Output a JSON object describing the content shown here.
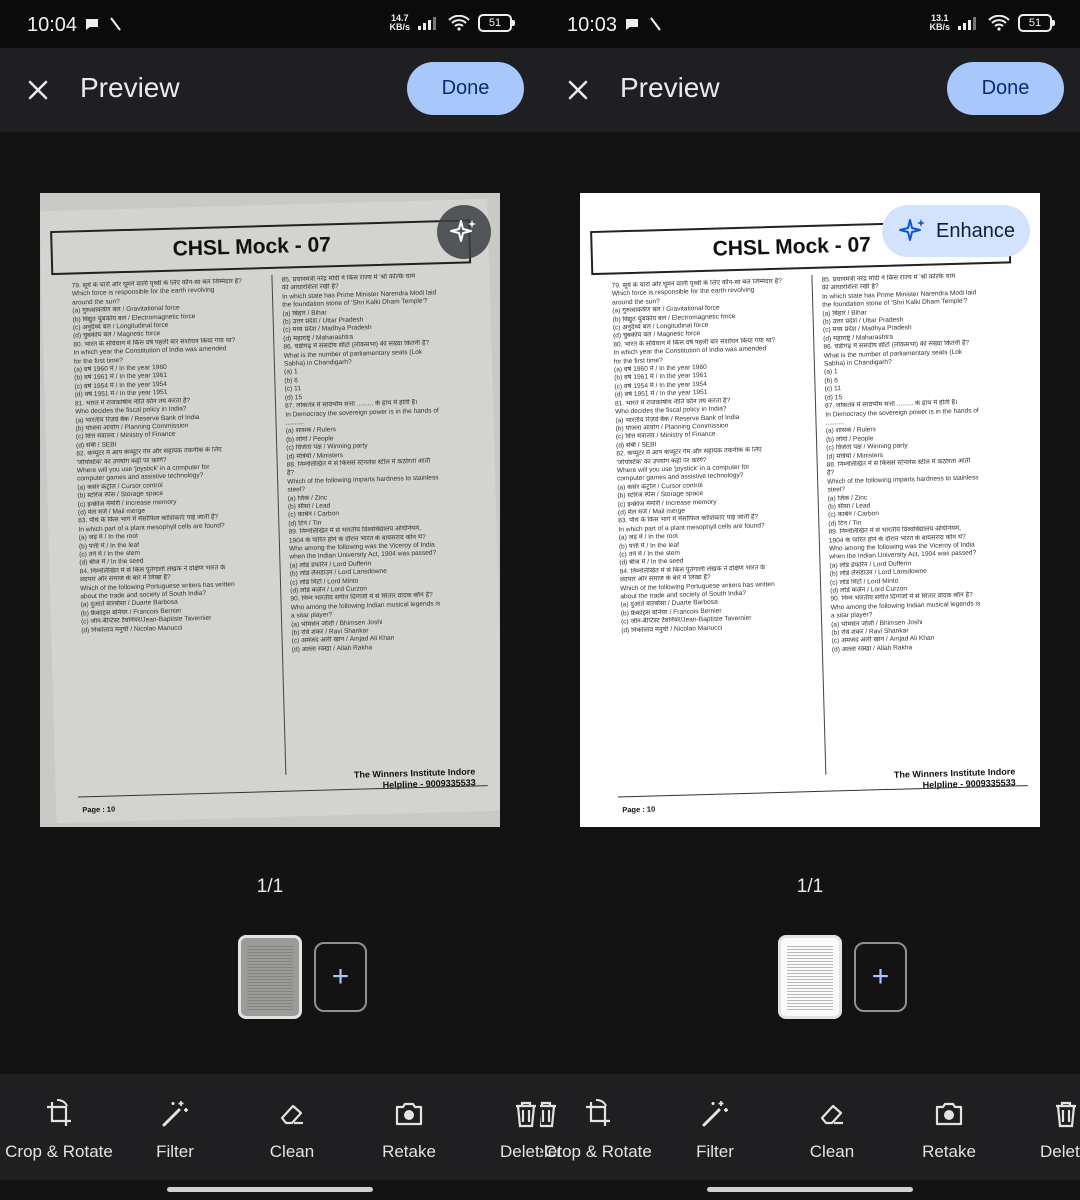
{
  "panels": [
    {
      "status": {
        "time": "10:04",
        "net_speed_top": "14.7",
        "net_speed_unit": "KB/s",
        "battery": "51"
      },
      "header": {
        "title": "Preview",
        "done_label": "Done"
      },
      "page_counter": "1/1",
      "tools": [
        "Crop & Rotate",
        "Filter",
        "Clean",
        "Retake",
        "Delet"
      ]
    },
    {
      "status": {
        "time": "10:03",
        "net_speed_top": "13.1",
        "net_speed_unit": "KB/s",
        "battery": "51"
      },
      "header": {
        "title": "Preview",
        "done_label": "Done"
      },
      "enhance_label": "Enhance",
      "page_counter": "1/1",
      "tools": [
        "Delet",
        "Crop & Rotate",
        "Filter",
        "Clean",
        "Retake",
        "Delet"
      ]
    }
  ],
  "document": {
    "title": "CHSL Mock - 07",
    "footer_org": "The Winners Institute Indore",
    "footer_helpline": "Helpline - 9009335533",
    "page_label": "Page : 10",
    "left_column": [
      "79. सूर्य के चारों ओर घूमने वाली पृथ्वी के लिए कौन-सा बल जिम्मेदार है?",
      "Which force is responsible for the earth revolving",
      "around the sun?",
      "(a) गुरुत्वाकर्षण बल / Gravitational force",
      "(b) विद्युत चुंबकीय बल / Electromagnetic force",
      "(c) अनुदैर्ध्य बल / Longitudinal force",
      "(d) चुंबकीय बल / Magnetic force",
      "80. भारत के संविधान में किस वर्ष पहली बार संशोधन किया गया था?",
      "In which year the Constitution of India was amended",
      "for the first time?",
      "(a) वर्ष 1960 में / In the year 1960",
      "(b) वर्ष 1961 में / In the year 1961",
      "(c) वर्ष 1954 में / In the year 1954",
      "(d) वर्ष 1951 में / In the year 1951",
      "81. भारत में राजकोषीय नीति कौन तय करता है?",
      "Who decides the fiscal policy in India?",
      "(a) भारतीय रिज़र्व बैंक / Reserve Bank of India",
      "(b) योजना आयोग / Planning Commission",
      "(c) वित्त मंत्रालय / Ministry of Finance",
      "(d) सेबी / SEBI",
      "82. कंप्यूटर में आप कंप्यूटर गेम और सहायक तकनीक के लिए",
      "'जॉयस्टिक' का उपयोग कहाँ पर करेंगे?",
      "Where will you use 'joystick' in a computer for",
      "computer games and assistive technology?",
      "(a) कर्सर कंट्रोल / Cursor control",
      "(b) स्टोरेज स्पेस / Storage space",
      "(c) इन्क्रीज मेमोरी / Increase memory",
      "(d) मेल मर्ज / Mail merge",
      "83. पौधे के किस भाग में मेसोफिल कोशिकाएं पाई जाती हैं?",
      "In which part of a plant mesophyll cells are found?",
      "(a) जड़ में / In the root",
      "(b) पत्ती में / In the leaf",
      "(c) तने में / In the stem",
      "(d) बीज में / In the seed",
      "84. निम्नलिखित में से किस पुर्तगाली लेखक ने दक्षिण भारत के",
      "व्यापार और समाज के बारे में लिखा है?",
      "Which of the following Portuguese writers has written",
      "about the trade and society of South India?",
      "(a) दुआर्ते बारबोसा / Duarte Barbosa",
      "(b) फ्रैंकोइस बर्नियर / Francois Bernier",
      "(c) जीन-बैप्टिस्ट टैवर्नियर/Jean-Baptiste Tavernier",
      "(d) निकोलाव मनुची / Nicolao Manucci"
    ],
    "right_column": [
      "85. प्रधानमंत्री नरेंद्र मोदी ने किस राज्य में 'श्री कल्कि धाम",
      "की आधारशिला रखी है?",
      "In which state has Prime Minister Narendra Modi laid",
      "the foundation stone of 'Shri Kalki Dham Temple'?",
      "(a) बिहार / Bihar",
      "(b) उत्तर प्रदेश / Uttar Pradesh",
      "(c) मध्य प्रदेश / Madhya Pradesh",
      "(d) महाराष्ट्र / Maharashtra",
      "86. चंडीगढ़ में संसदीय सीटों (लोकसभा) की संख्या कितनी है?",
      "What is the number of parliamentary seats (Lok",
      "Sabha) in Chandigarh?",
      "(a) 1",
      "(b) 6",
      "(c) 11",
      "(d) 15",
      "87. लोकतंत्र में सार्वभौम सत्ता ......... के हाथ में होती है।",
      "In Democracy the sovereign power is in the hands of",
      "..........",
      "(a) शासक / Rulers",
      "(b) लोगों / People",
      "(c) विजेता पक्ष / Winning party",
      "(d) मंत्रियों / Ministers",
      "88. निम्नलिखित में से किससे स्टेनलेस स्टील में कठोरता आती",
      "है?",
      "Which of the following imparts hardness to stainless",
      "steel?",
      "(a) जिंक / Zinc",
      "(b) सीसा / Lead",
      "(c) कार्बन / Carbon",
      "(d) टिन / Tin",
      "89. निम्नलिखित में से भारतीय विश्वविद्यालय अधिनियम,",
      "1904 के पारित होने के दौरान भारत के वायसराय कौन थे?",
      "Who among the following was the Viceroy of India",
      "when the Indian University Act, 1904 was passed?",
      "(a) लॉर्ड डफरिन / Lord Dufferin",
      "(b) लॉर्ड लैंसडाउन / Lord Lansdowne",
      "(c) लॉर्ड मिंटो / Lord Minto",
      "(d) लॉर्ड कर्ज़न / Lord Curzon",
      "90. निम्न भारतीय संगीत दिग्गजों में से सितार वादक कौन है?",
      "Who among the following Indian musical legends is",
      "a sitar player?",
      "(a) भीमसेन जोशी / Bhimsen Joshi",
      "(b) रवि शंकर / Ravi Shankar",
      "(c) अमजद अली खान / Amjad Ali Khan",
      "(d) अल्ला रक्खा / Allah Rakha"
    ]
  }
}
